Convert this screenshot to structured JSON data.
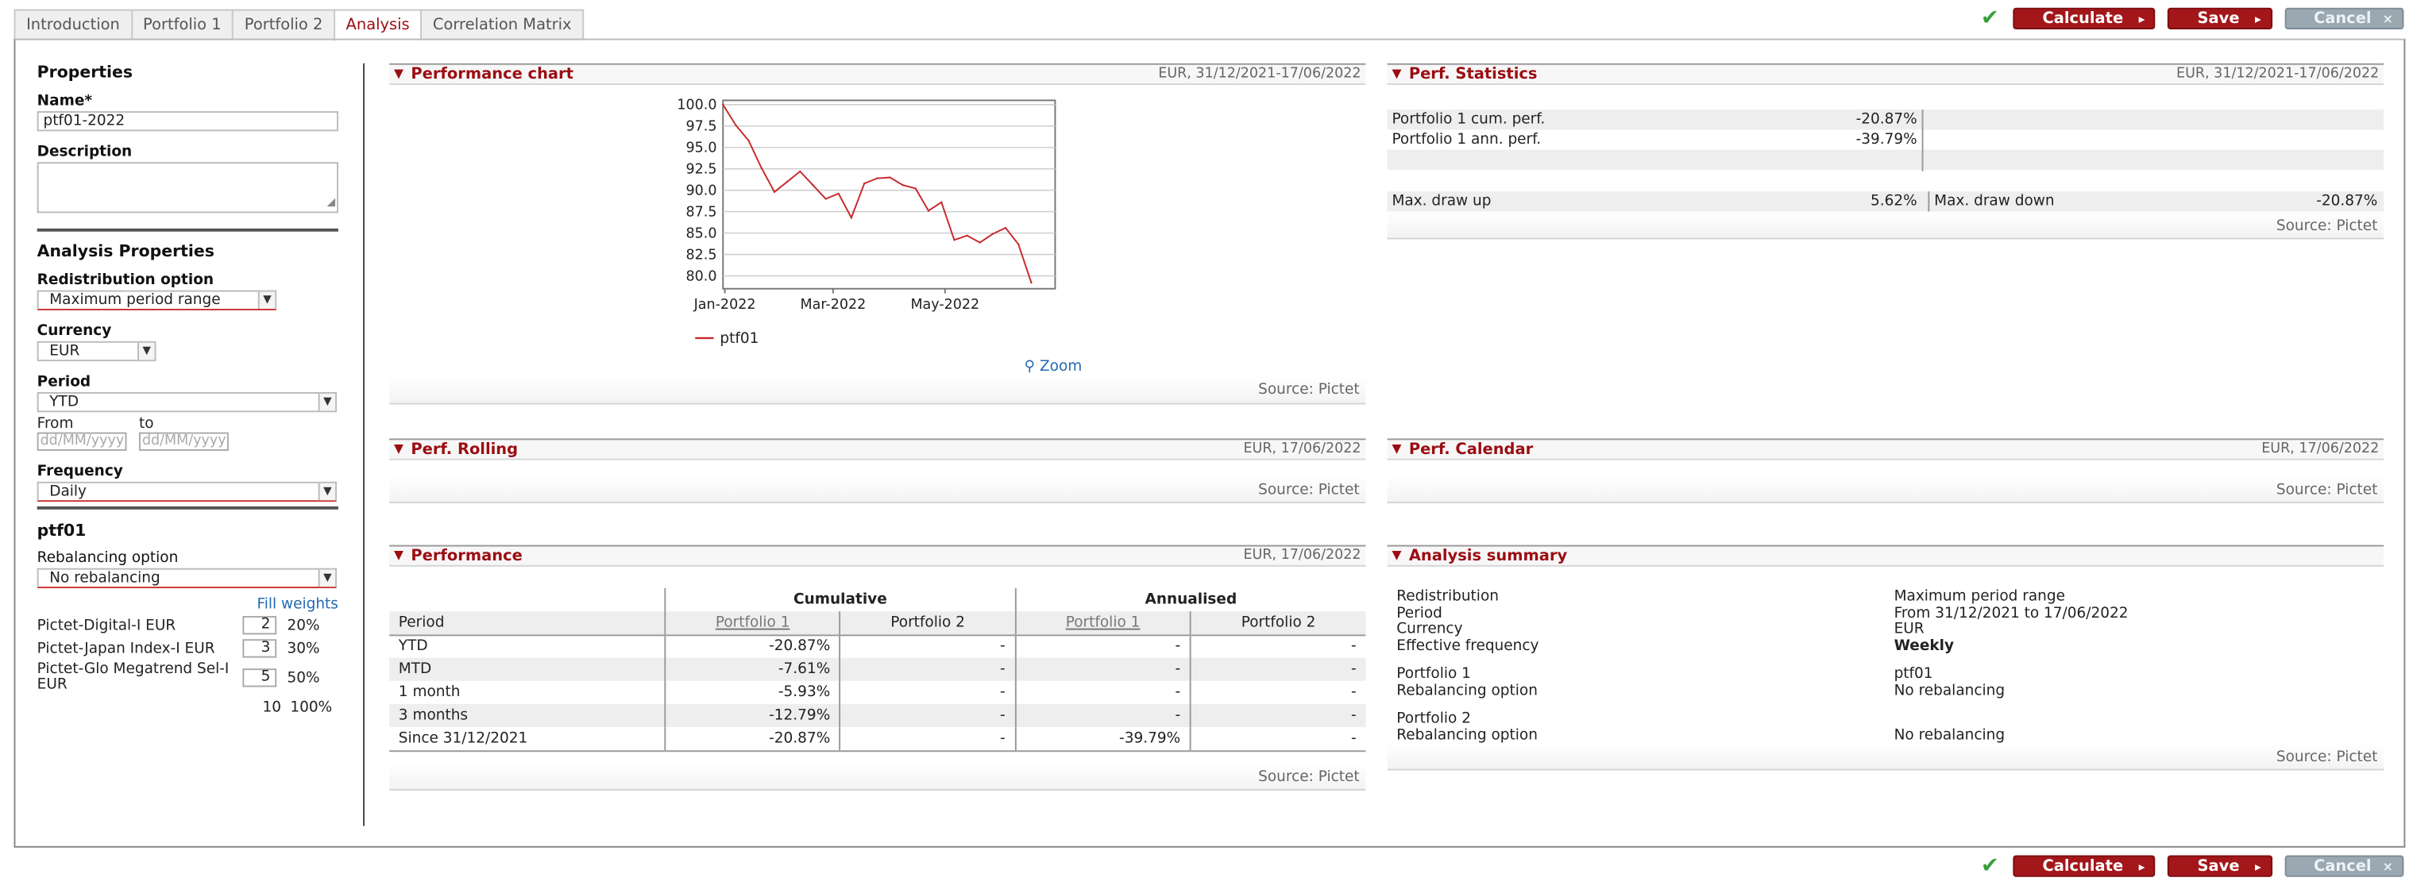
{
  "tabs": [
    "Introduction",
    "Portfolio 1",
    "Portfolio 2",
    "Analysis",
    "Correlation Matrix"
  ],
  "active_tab": "Analysis",
  "actions": {
    "calculate": "Calculate",
    "save": "Save",
    "cancel": "Cancel",
    "chev": "▸",
    "cancel_x": "×"
  },
  "left": {
    "properties_title": "Properties",
    "name_label": "Name*",
    "name_value": "ptf01-2022",
    "description_label": "Description",
    "analysis_props_title": "Analysis Properties",
    "redistribution_label": "Redistribution option",
    "redistribution_value": "Maximum period range",
    "currency_label": "Currency",
    "currency_value": "EUR",
    "period_label": "Period",
    "period_value": "YTD",
    "from_label": "From",
    "to_label": "to",
    "date_placeholder": "dd/MM/yyyy",
    "frequency_label": "Frequency",
    "frequency_value": "Daily",
    "portfolio_title": "ptf01",
    "rebalancing_label": "Rebalancing option",
    "rebalancing_value": "No rebalancing",
    "fill_weights": "Fill weights",
    "weights": [
      {
        "name": "Pictet-Digital-I EUR",
        "qty": "2",
        "pct": "20%"
      },
      {
        "name": "Pictet-Japan Index-I EUR",
        "qty": "3",
        "pct": "30%"
      },
      {
        "name": "Pictet-Glo Megatrend Sel-I EUR",
        "qty": "5",
        "pct": "50%"
      }
    ],
    "total_qty": "10",
    "total_pct": "100%"
  },
  "sections": {
    "perf_chart": {
      "title": "Performance chart",
      "meta": "EUR, 31/12/2021-17/06/2022",
      "zoom": "Zoom",
      "source": "Source: Pictet"
    },
    "perf_stats": {
      "title": "Perf. Statistics",
      "meta": "EUR, 31/12/2021-17/06/2022",
      "source": "Source: Pictet",
      "cum_label": "Portfolio 1 cum. perf.",
      "cum_value": "-20.87%",
      "ann_label": "Portfolio 1 ann. perf.",
      "ann_value": "-39.79%",
      "drawup_label": "Max. draw up",
      "drawup_value": "5.62%",
      "drawdown_label": "Max. draw down",
      "drawdown_value": "-20.87%"
    },
    "perf_rolling": {
      "title": "Perf. Rolling",
      "meta": "EUR, 17/06/2022",
      "source": "Source: Pictet"
    },
    "perf_calendar": {
      "title": "Perf. Calendar",
      "meta": "EUR, 17/06/2022",
      "source": "Source: Pictet"
    },
    "performance": {
      "title": "Performance",
      "meta": "EUR, 17/06/2022",
      "source": "Source: Pictet",
      "group_cumulative": "Cumulative",
      "group_annualised": "Annualised",
      "col_period": "Period",
      "col_p1": "Portfolio 1",
      "col_p2": "Portfolio 2",
      "rows": [
        {
          "period": "YTD",
          "c1": "-20.87%",
          "c2": "-",
          "a1": "-",
          "a2": "-"
        },
        {
          "period": "MTD",
          "c1": "-7.61%",
          "c2": "-",
          "a1": "-",
          "a2": "-"
        },
        {
          "period": "1 month",
          "c1": "-5.93%",
          "c2": "-",
          "a1": "-",
          "a2": "-"
        },
        {
          "period": "3 months",
          "c1": "-12.79%",
          "c2": "-",
          "a1": "-",
          "a2": "-"
        },
        {
          "period": "Since 31/12/2021",
          "c1": "-20.87%",
          "c2": "-",
          "a1": "-39.79%",
          "a2": "-"
        }
      ]
    },
    "analysis_summary": {
      "title": "Analysis summary",
      "source": "Source: Pictet",
      "redistribution_l": "Redistribution",
      "redistribution_v": "Maximum period range",
      "period_l": "Period",
      "period_v": "From 31/12/2021 to 17/06/2022",
      "currency_l": "Currency",
      "currency_v": "EUR",
      "freq_l": "Effective frequency",
      "freq_v": "Weekly",
      "p1_l": "Portfolio 1",
      "p1_v": "ptf01",
      "p1_reb_l": "Rebalancing option",
      "p1_reb_v": "No rebalancing",
      "p2_l": "Portfolio 2",
      "p2_reb_l": "Rebalancing option",
      "p2_reb_v": "No rebalancing"
    }
  },
  "chart_data": {
    "type": "line",
    "x_ticks": [
      "Jan-2022",
      "Mar-2022",
      "May-2022"
    ],
    "y_ticks": [
      "100.0",
      "97.5",
      "95.0",
      "92.5",
      "90.0",
      "87.5",
      "85.0",
      "82.5",
      "80.0"
    ],
    "ylim": [
      78.5,
      100.5
    ],
    "xlim": [
      "2021-12-31",
      "2022-06-30"
    ],
    "grid": true,
    "legend": "bottom-left",
    "series": [
      {
        "name": "ptf01",
        "color": "#c8282c",
        "x": [
          "2021-12-31",
          "2022-01-07",
          "2022-01-14",
          "2022-01-21",
          "2022-01-28",
          "2022-02-04",
          "2022-02-11",
          "2022-02-18",
          "2022-02-25",
          "2022-03-04",
          "2022-03-11",
          "2022-03-18",
          "2022-03-25",
          "2022-04-01",
          "2022-04-08",
          "2022-04-15",
          "2022-04-22",
          "2022-04-29",
          "2022-05-06",
          "2022-05-13",
          "2022-05-20",
          "2022-05-27",
          "2022-06-03",
          "2022-06-10",
          "2022-06-17"
        ],
        "y": [
          100.0,
          97.6,
          95.8,
          92.6,
          89.8,
          91.0,
          92.2,
          90.6,
          89.0,
          89.6,
          86.8,
          90.8,
          91.4,
          91.5,
          90.6,
          90.2,
          87.6,
          88.6,
          84.2,
          84.7,
          83.9,
          84.9,
          85.6,
          83.7,
          79.2
        ]
      }
    ]
  }
}
